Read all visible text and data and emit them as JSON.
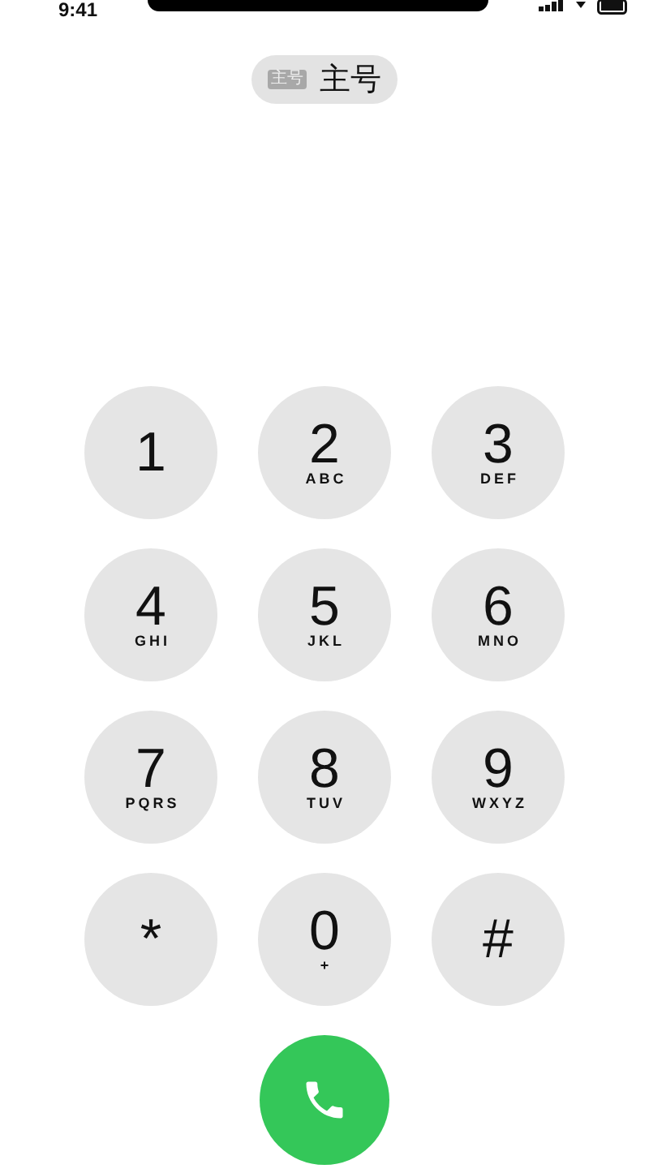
{
  "status_bar": {
    "time": "9:41"
  },
  "line_selector": {
    "tag": "主号",
    "label": "主号"
  },
  "keypad": [
    {
      "digit": "1"
    },
    {
      "digit": "2",
      "letters": "ABC"
    },
    {
      "digit": "3",
      "letters": "DEF"
    },
    {
      "digit": "4",
      "letters": "GHI"
    },
    {
      "digit": "5",
      "letters": "JKL"
    },
    {
      "digit": "6",
      "letters": "MNO"
    },
    {
      "digit": "7",
      "letters": "PQRS"
    },
    {
      "digit": "8",
      "letters": "TUV"
    },
    {
      "digit": "9",
      "letters": "WXYZ"
    },
    {
      "digit": "*"
    },
    {
      "digit": "0",
      "letters": "+"
    },
    {
      "digit": "#"
    }
  ]
}
